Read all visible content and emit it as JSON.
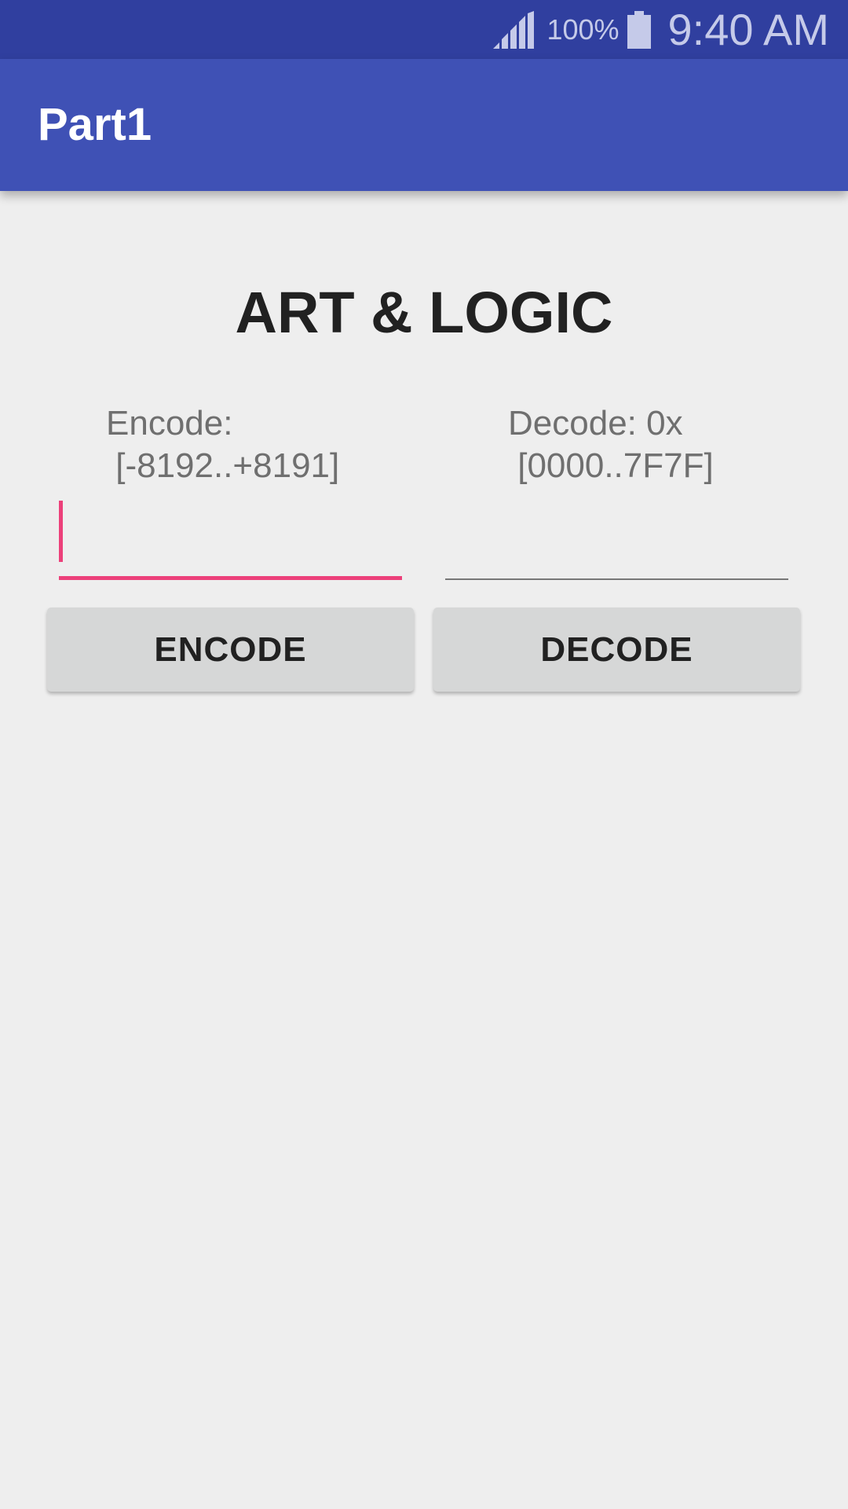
{
  "status_bar": {
    "signal_icon": "cell-signal-icon",
    "battery_percent": "100%",
    "battery_icon": "battery-full-icon",
    "time": "9:40 AM"
  },
  "app_bar": {
    "title": "Part1"
  },
  "main": {
    "headline": "ART & LOGIC",
    "encode": {
      "label": "Encode:\n [-8192..+8191]",
      "value": "",
      "button_label": "ENCODE"
    },
    "decode": {
      "label": "Decode: 0x\n [0000..7F7F]",
      "value": "",
      "button_label": "DECODE"
    }
  },
  "colors": {
    "status_bar": "#303f9f",
    "app_bar": "#3f51b5",
    "accent": "#ec407a",
    "background": "#eeeeee",
    "button": "#d6d7d7"
  }
}
